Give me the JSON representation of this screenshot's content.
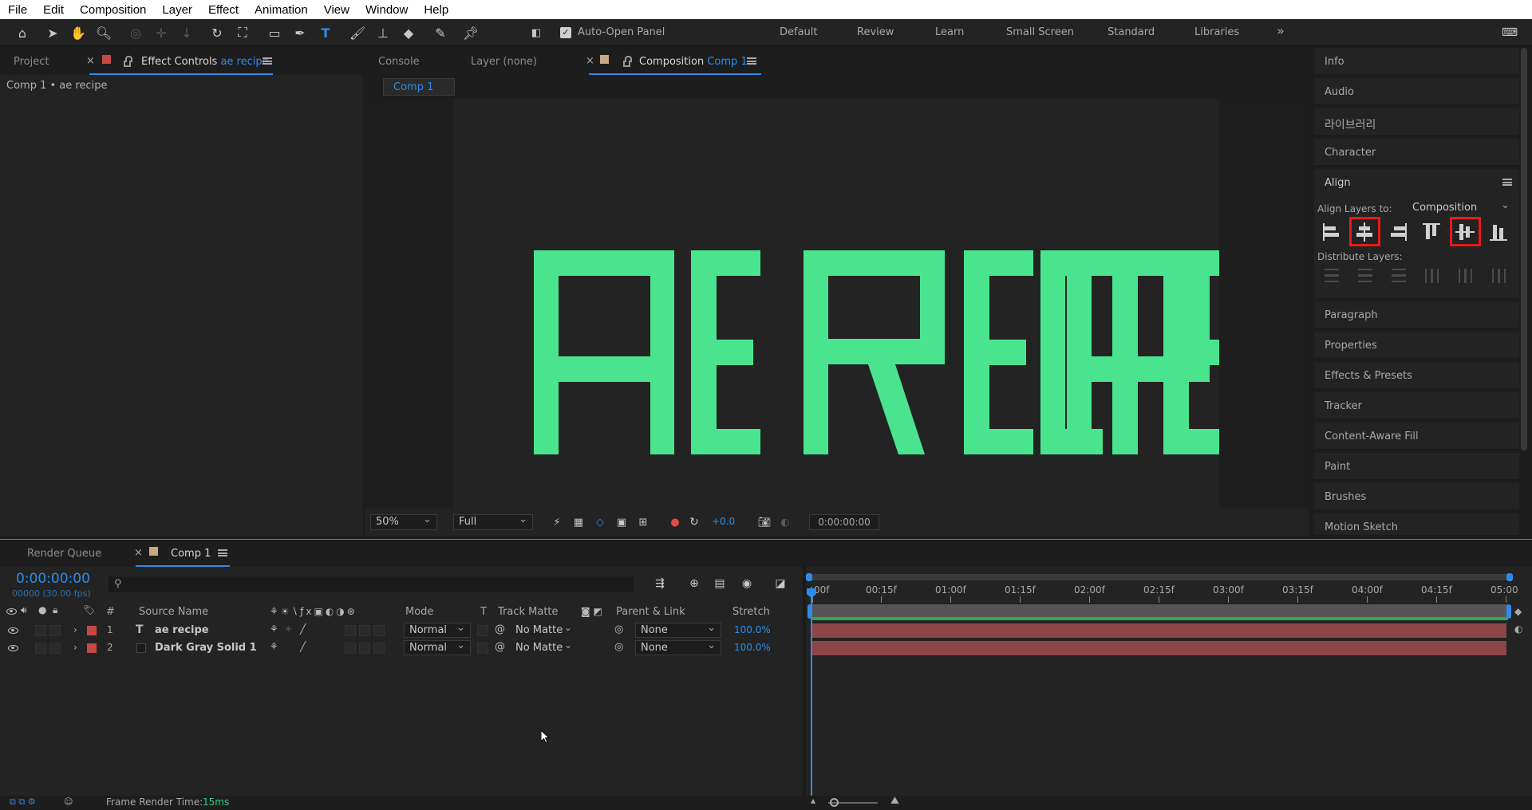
{
  "menu": [
    "File",
    "Edit",
    "Composition",
    "Layer",
    "Effect",
    "Animation",
    "View",
    "Window",
    "Help"
  ],
  "toolbar": {
    "auto_open_label": "Auto-Open Panel",
    "workspaces": [
      "Default",
      "Review",
      "Learn",
      "Small Screen",
      "Standard",
      "Libraries"
    ],
    "more": "»"
  },
  "left_panel": {
    "tab_project": "Project",
    "tab_effect_controls": "Effect Controls",
    "tab_effect_layer": "ae recipe",
    "breadcrumb": "Comp 1 • ae recipe"
  },
  "comp_panel": {
    "tab_console": "Console",
    "tab_layer": "Layer (none)",
    "tab_composition": "Composition",
    "tab_comp_name": "Comp 1",
    "subtab": "Comp 1",
    "canvas_text": "AE RECIPE",
    "zoom": "50%",
    "resolution": "Full",
    "exposure": "+0.0",
    "timecode": "0:00:00:00",
    "colors": {
      "canvas_bg": "#232323",
      "text_color": "#4ae48f"
    }
  },
  "right_panel": {
    "sections": [
      "Info",
      "Audio",
      "라이브러리",
      "Character"
    ],
    "align_title": "Align",
    "align_layers_to_label": "Align Layers to:",
    "align_layers_to_value": "Composition",
    "distribute_label": "Distribute Layers:",
    "sections_after": [
      "Paragraph",
      "Properties",
      "Effects & Presets",
      "Tracker",
      "Content-Aware Fill",
      "Paint",
      "Brushes",
      "Motion Sketch"
    ]
  },
  "timeline": {
    "tab_render_queue": "Render Queue",
    "tab_comp": "Comp 1",
    "current_time": "0:00:00:00",
    "frame_info": "00000 (30.00 fps)",
    "search_placeholder": "",
    "columns": {
      "num": "#",
      "source": "Source Name",
      "mode": "Mode",
      "t": "T",
      "track_matte": "Track Matte",
      "parent": "Parent & Link",
      "stretch": "Stretch"
    },
    "ruler": [
      "00f",
      "00:15f",
      "01:00f",
      "01:15f",
      "02:00f",
      "02:15f",
      "03:00f",
      "03:15f",
      "04:00f",
      "04:15f",
      "05:00"
    ],
    "layers": [
      {
        "num": "1",
        "type": "T",
        "name": "ae recipe",
        "mode": "Normal",
        "matte": "No Matte",
        "parent": "None",
        "stretch": "100.0%",
        "color": "#c84848"
      },
      {
        "num": "2",
        "type": "",
        "name": "Dark Gray Solid 1",
        "mode": "Normal",
        "matte": "No Matte",
        "parent": "None",
        "stretch": "100.0%",
        "color": "#c84848"
      }
    ],
    "footer_label": "Frame Render Time:",
    "footer_value": "15ms"
  }
}
